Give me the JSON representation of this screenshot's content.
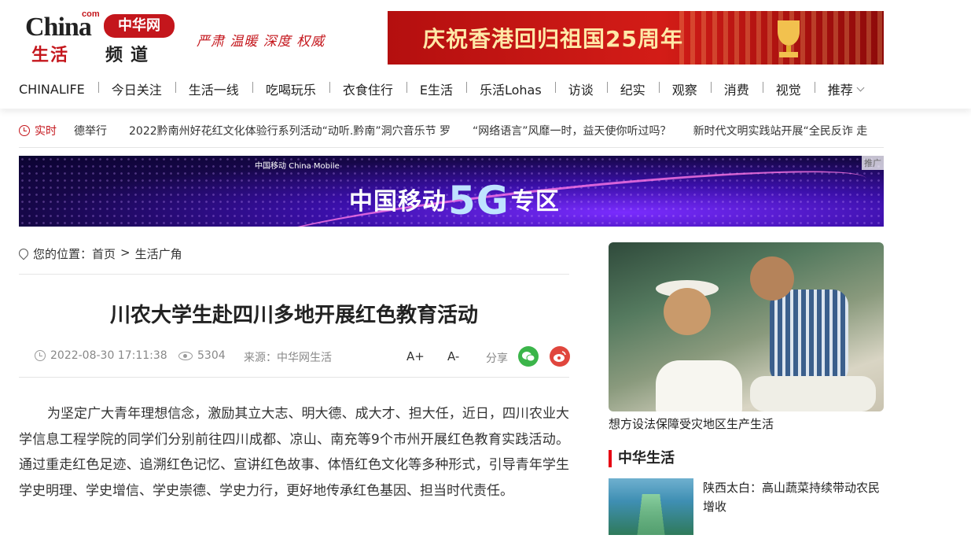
{
  "header": {
    "logo": {
      "brand": "China",
      "com": "com",
      "badge": "中华网",
      "channel_a": "生活",
      "channel_b": "频道"
    },
    "slogan": "严肃 温暖 深度 权威",
    "top_banner": "庆祝香港回归祖国25周年",
    "nav": [
      "CHINALIFE",
      "今日关注",
      "生活一线",
      "吃喝玩乐",
      "衣食住行",
      "E生活",
      "乐活Lohas",
      "访谈",
      "纪实",
      "观察",
      "消费",
      "视觉",
      "推荐"
    ]
  },
  "ticker": {
    "label": "实时",
    "items": [
      "德举行",
      "2022黔南州好花红文化体验行系列活动“动听.黔南”洞穴音乐节 罗",
      "“网络语言”风靡一时，益天使你听过吗？",
      "新时代文明实践站开展“全民反诈 走"
    ]
  },
  "banner5g": {
    "brand": "中国移动 China Mobile",
    "prefix": "中国移动",
    "big": "5G",
    "suffix": "专区",
    "ad": "推广"
  },
  "breadcrumb": {
    "label": "您的位置：",
    "home": "首页",
    "sep": ">",
    "section": "生活广角"
  },
  "article": {
    "title": "川农大学生赴四川多地开展红色教育活动",
    "date": "2022-08-30 17:11:38",
    "views": "5304",
    "source": "来源：中华网生活",
    "font_plus": "A+",
    "font_minus": "A-",
    "share_label": "分享",
    "body": "为坚定广大青年理想信念，激励其立大志、明大德、成大才、担大任，近日，四川农业大学信息工程学院的同学们分别前往四川成都、凉山、南充等9个市州开展红色教育实践活动。通过重走红色足迹、追溯红色记忆、宣讲红色故事、体悟红色文化等多种形式，引导青年学生学史明理、学史增信、学史崇德、学史力行，更好地传承红色基因、担当时代责任。"
  },
  "sidebar": {
    "featured_caption": "想方设法保障受灾地区生产生活",
    "section_title": "中华生活",
    "items": [
      {
        "title": "陕西太白：高山蔬菜持续带动农民增收"
      }
    ]
  },
  "colors": {
    "brand_red": "#c4161c",
    "accent_red": "#e60012",
    "wechat_green": "#3bb54a",
    "weibo_red": "#e0463d"
  }
}
